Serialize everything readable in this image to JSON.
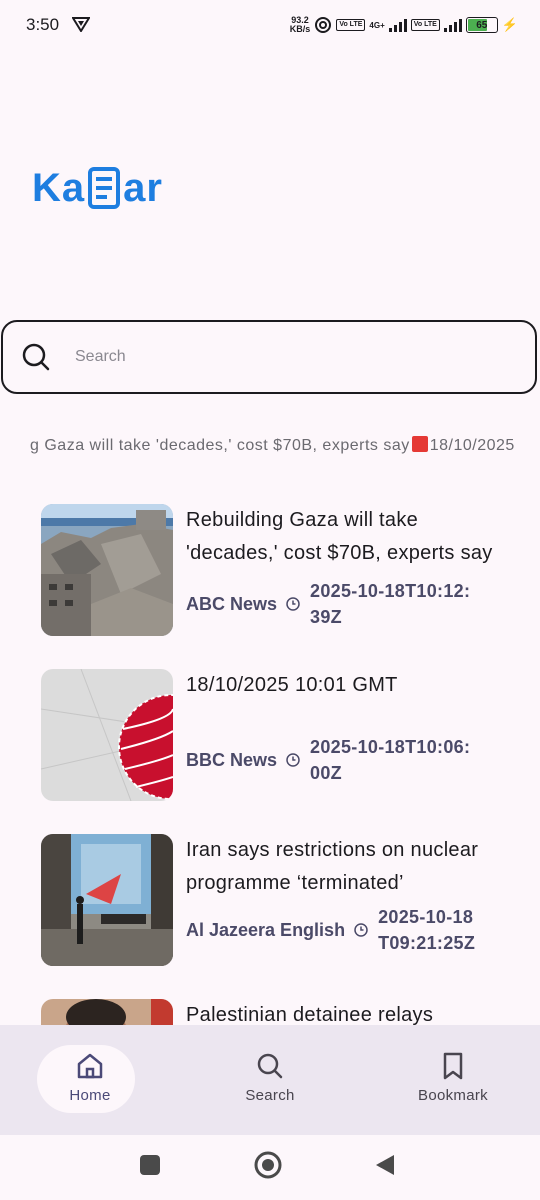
{
  "status_bar": {
    "time": "3:50",
    "speed_value": "93.2",
    "speed_unit": "KB/s",
    "sim1_label": "Vo LTE",
    "sim1_net": "4G+",
    "sim2_label": "Vo LTE",
    "battery": "65"
  },
  "app": {
    "logo_prefix": "Ka",
    "logo_suffix": "ar"
  },
  "search": {
    "placeholder": "Search"
  },
  "ticker": {
    "text_before": "g Gaza will take 'decades,' cost $70B, experts say",
    "text_after": "18/10/2025"
  },
  "news": [
    {
      "title": "Rebuilding Gaza will take 'decades,' cost $70B, experts say",
      "source": "ABC News",
      "date_line1": "2025-10-18T10:12:",
      "date_line2": "39Z"
    },
    {
      "title": "18/10/2025 10:01 GMT",
      "source": "BBC News",
      "date_line1": "2025-10-18T10:06:",
      "date_line2": "00Z"
    },
    {
      "title": "Iran says restrictions on nuclear programme ‘terminated’",
      "source": "Al Jazeera English",
      "date_line1": "2025-10-18",
      "date_line2": "T09:21:25Z"
    },
    {
      "title": "Palestinian detainee relays",
      "source": "",
      "date_line1": "",
      "date_line2": ""
    }
  ],
  "bottom_nav": {
    "items": [
      {
        "label": "Home",
        "icon": "home-icon",
        "active": true
      },
      {
        "label": "Search",
        "icon": "search-icon",
        "active": false
      },
      {
        "label": "Bookmark",
        "icon": "bookmark-icon",
        "active": false
      }
    ]
  },
  "colors": {
    "brand": "#1e7ee0",
    "nav_bg": "#ece6f0",
    "meta_text": "#4b4a68"
  }
}
